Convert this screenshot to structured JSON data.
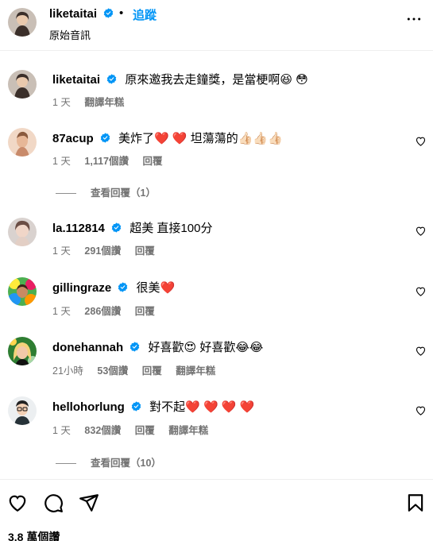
{
  "header": {
    "username": "liketaitai",
    "dot": "•",
    "follow_label": "追蹤",
    "audio_label": "原始音訊"
  },
  "colors": {
    "accent": "#0095f6",
    "verified": "#0095f6",
    "heart": "#ed4956",
    "muted": "#737373"
  },
  "comments": [
    {
      "username": "liketaitai",
      "text": "原來邀我去走鐘獎，是當梗啊😆 😳",
      "time": "1 天",
      "likes": "",
      "reply": "",
      "translate": "翻譯年糕",
      "like_button": false,
      "avatar": "woman-portrait"
    },
    {
      "username": "87acup",
      "text": "美炸了❤️ ❤️  坦蕩蕩的👍🏻👍🏻👍🏻",
      "time": "1 天",
      "likes": "1,117個讚",
      "reply": "回覆",
      "translate": "",
      "like_button": true,
      "avatar": "illustration"
    },
    {
      "username": "la.112814",
      "text": "超美 直接100分",
      "time": "1 天",
      "likes": "291個讚",
      "reply": "回覆",
      "translate": "",
      "like_button": true,
      "avatar": "portrait"
    },
    {
      "username": "gillingraze",
      "text": "很美❤️",
      "time": "1 天",
      "likes": "286個讚",
      "reply": "回覆",
      "translate": "",
      "like_button": true,
      "avatar": "colorful"
    },
    {
      "username": "donehannah",
      "text": "好喜歡😍 好喜歡😂😂",
      "time": "21小時",
      "likes": "53個讚",
      "reply": "回覆",
      "translate": "翻譯年糕",
      "like_button": true,
      "avatar": "blonde"
    },
    {
      "username": "hellohorlung",
      "text": "對不起❤️ ❤️ ❤️ ❤️",
      "time": "1 天",
      "likes": "832個讚",
      "reply": "回覆",
      "translate": "翻譯年糕",
      "like_button": true,
      "avatar": "glasses-man"
    }
  ],
  "view_replies": [
    {
      "label": "查看回覆（1）"
    },
    {
      "label": "查看回覆（10）"
    }
  ],
  "footer": {
    "likes_label": "3.8 萬個讚",
    "icons": [
      "heart-icon",
      "comment-icon",
      "share-icon",
      "bookmark-icon"
    ]
  }
}
